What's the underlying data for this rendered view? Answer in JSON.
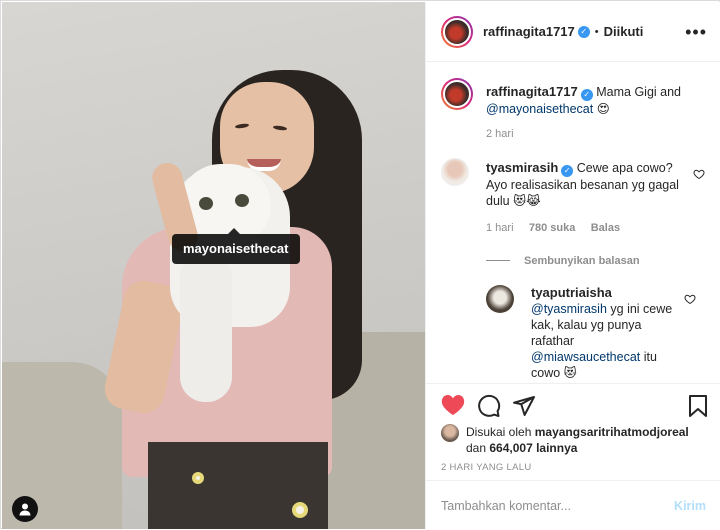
{
  "photo": {
    "tag_label": "mayonaisethecat",
    "user_tag_icon": "user-icon"
  },
  "header": {
    "username": "raffinagita1717",
    "separator": "•",
    "follow_status": "Diikuti",
    "more_icon": "ellipsis-icon"
  },
  "caption": {
    "username": "raffinagita1717",
    "text_start": "Mama Gigi and",
    "mention": "@mayonaisethecat",
    "emoji": "😍",
    "time": "2 hari"
  },
  "comment": {
    "username": "tyasmirasih",
    "text": "Cewe apa cowo? Ayo realisasikan besanan yg gagal dulu",
    "emoji": "😻😹",
    "time": "1 hari",
    "likes": "780 suka",
    "reply_label": "Balas",
    "hide_replies": "Sembunyikan balasan"
  },
  "reply": {
    "username": "tyaputriaisha",
    "mention1": "@tyasmirasih",
    "text1": "yg ini cewe kak, kalau yg punya rafathar",
    "mention2": "@miawsaucethecat",
    "text2": "itu cowo",
    "emoji": "😻"
  },
  "actions": {
    "like_icon": "heart-filled-icon",
    "comment_icon": "comment-icon",
    "share_icon": "share-icon",
    "save_icon": "bookmark-icon",
    "liked_by_prefix": "Disukai oleh",
    "liked_by_user": "mayangsaritrihatmodjoreal",
    "liked_by_and": "dan",
    "liked_by_count": "664,007 lainnya",
    "date": "2 HARI YANG LALU"
  },
  "add_comment": {
    "placeholder": "Tambahkan komentar...",
    "post_label": "Kirim"
  },
  "colors": {
    "like_red": "#ed4956",
    "link_blue": "#00376b",
    "verified_blue": "#3897f0",
    "post_disabled": "#b2dffc"
  }
}
